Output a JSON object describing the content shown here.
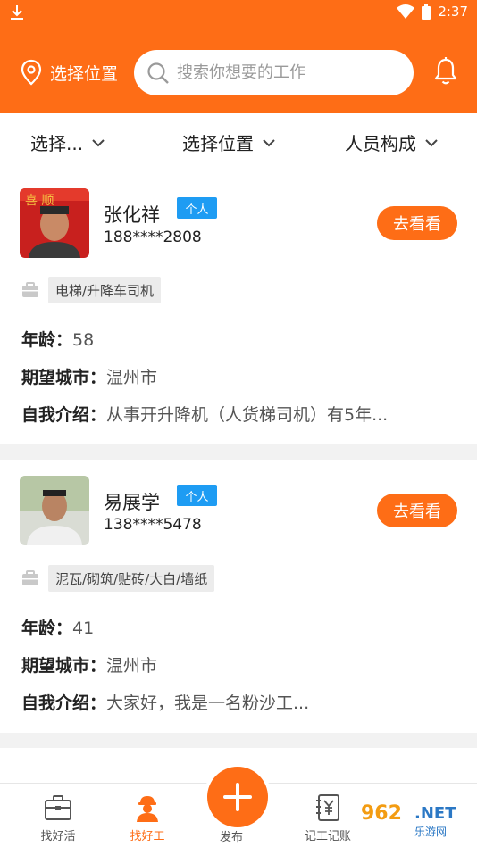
{
  "status_bar": {
    "time": "2:37"
  },
  "header": {
    "location_label": "选择位置",
    "search_placeholder": "搜索你想要的工作"
  },
  "filters": [
    {
      "label": "选择..."
    },
    {
      "label": "选择位置"
    },
    {
      "label": "人员构成"
    }
  ],
  "workers": [
    {
      "name": "张化祥",
      "badge": "个人",
      "phone": "188****2808",
      "action": "去看看",
      "job": "电梯/升降车司机",
      "age_label": "年龄：",
      "age": "58",
      "city_label": "期望城市：",
      "city": "温州市",
      "intro_label": "自我介绍：",
      "intro": "从事开升降机（人货梯司机）有5年..."
    },
    {
      "name": "易展学",
      "badge": "个人",
      "phone": "138****5478",
      "action": "去看看",
      "job": "泥瓦/砌筑/贴砖/大白/墙纸",
      "age_label": "年龄：",
      "age": "41",
      "city_label": "期望城市：",
      "city": "温州市",
      "intro_label": "自我介绍：",
      "intro": "大家好，我是一名粉沙工..."
    }
  ],
  "bottom_nav": [
    {
      "label": "找好活",
      "icon": "briefcase-icon"
    },
    {
      "label": "找好工",
      "icon": "worker-icon",
      "active": true
    },
    {
      "label": "发布",
      "icon": "plus-icon"
    },
    {
      "label": "记工记账",
      "icon": "ledger-icon"
    }
  ],
  "watermark": {
    "number": "962",
    "suffix": ".NET",
    "text": "乐游网"
  },
  "colors": {
    "accent": "#fe6d16",
    "badge": "#1e9cf3"
  }
}
